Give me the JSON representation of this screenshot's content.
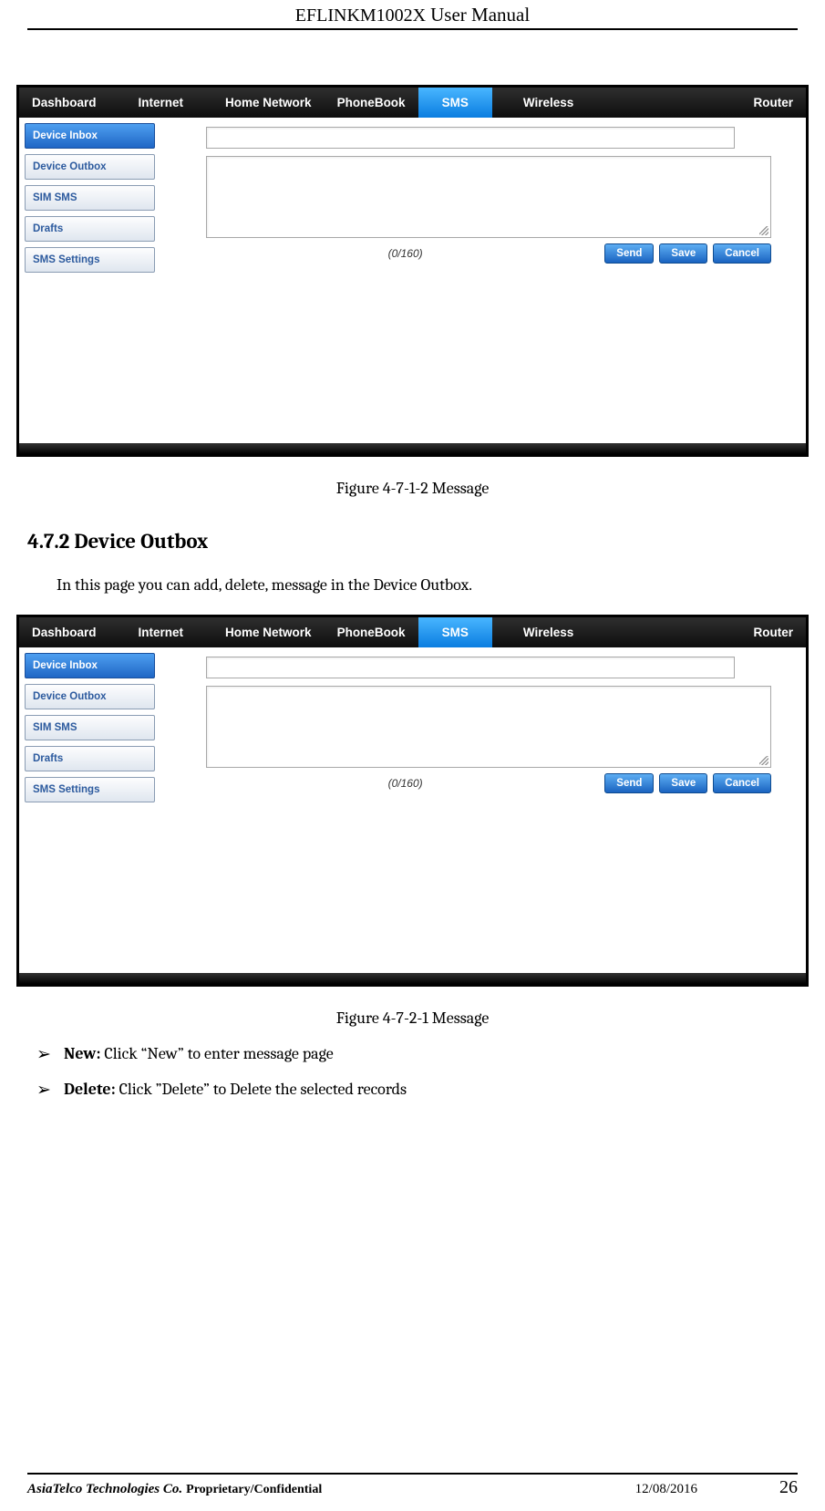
{
  "header": {
    "product": "EFLINKM1002X",
    "label": "User Manual"
  },
  "nav": {
    "dashboard": "Dashboard",
    "internet": "Internet",
    "homenet": "Home Network",
    "phonebook": "PhoneBook",
    "sms": "SMS",
    "wireless": "Wireless",
    "router": "Router"
  },
  "sidebar": {
    "inbox": "Device Inbox",
    "outbox": "Device Outbox",
    "sim": "SIM SMS",
    "drafts": "Drafts",
    "settings": "SMS Settings"
  },
  "compose": {
    "counter": "(0/160)",
    "send": "Send",
    "save": "Save",
    "cancel": "Cancel"
  },
  "captions": {
    "fig1": "Figure 4-7-1-2 Message",
    "fig2": "Figure 4-7-2-1 Message"
  },
  "section": {
    "heading": "4.7.2 Device Outbox",
    "intro": "In this page you can add, delete, message in the Device Outbox."
  },
  "bullets": {
    "new_label": "New:",
    "new_text": " Click “New” to enter message page",
    "delete_label": "Delete:",
    "delete_text": " Click ”Delete” to Delete the selected records"
  },
  "footer": {
    "company": "AsiaTelco Technologies Co.",
    "pc": "Proprietary/Confidential",
    "date": "12/08/2016",
    "page": "26"
  }
}
